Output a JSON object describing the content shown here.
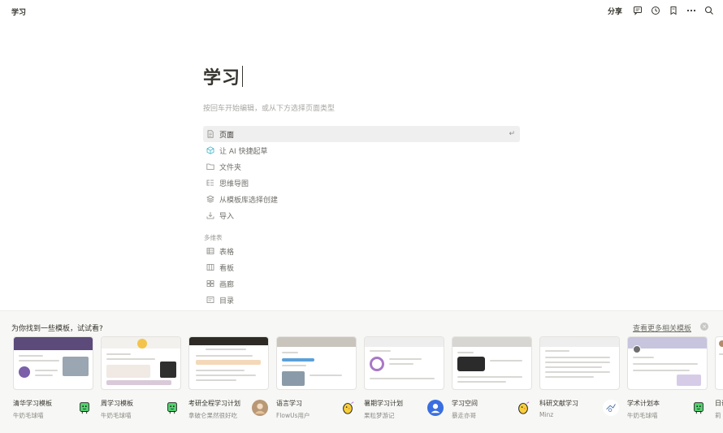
{
  "topbar": {
    "breadcrumb": "学习",
    "share_label": "分享",
    "icons": [
      "comment-icon",
      "history-icon",
      "bookmark-icon",
      "more-icon",
      "search-icon"
    ]
  },
  "editor": {
    "title": "学习",
    "hint": "按回车开始编辑，或从下方选择页面类型",
    "enter_symbol": "↵",
    "menu": [
      {
        "label": "页面",
        "icon": "page-icon"
      },
      {
        "label": "让 AI 快捷起草",
        "icon": "ai-cube-icon"
      },
      {
        "label": "文件夹",
        "icon": "folder-icon"
      },
      {
        "label": "思维导图",
        "icon": "mindmap-icon"
      },
      {
        "label": "从模板库选择创建",
        "icon": "template-icon"
      },
      {
        "label": "导入",
        "icon": "import-icon"
      }
    ],
    "section_label": "多维表",
    "table_menu": [
      {
        "label": "表格",
        "icon": "table-icon"
      },
      {
        "label": "看板",
        "icon": "kanban-icon"
      },
      {
        "label": "画廊",
        "icon": "gallery-icon"
      },
      {
        "label": "目录",
        "icon": "list-icon"
      }
    ]
  },
  "templates": {
    "title": "为你找到一些模板，试试看?",
    "more_link": "查看更多相关模板",
    "close_symbol": "×",
    "cards": [
      {
        "name": "清华学习模板",
        "author": "牛奶毛球喵",
        "band": "#5b4a7a",
        "avatar": "green-robot"
      },
      {
        "name": "周学习模板",
        "author": "牛奶毛球喵",
        "band": "#f3f1ee",
        "avatar": "green-robot"
      },
      {
        "name": "考研全程学习计划",
        "author": "拿破仑果然很好吃",
        "band": "#2e2a26",
        "avatar": "photo"
      },
      {
        "name": "语言学习",
        "author": "FlowUs用户",
        "band": "#c9c5bd",
        "avatar": "yellow-bird"
      },
      {
        "name": "暑期学习计划",
        "author": "果粒梦游记",
        "band": "#eeeeee",
        "avatar": "blue-person"
      },
      {
        "name": "学习空间",
        "author": "暴走亦哥",
        "band": "#d8d6d2",
        "avatar": "yellow-bird"
      },
      {
        "name": "科研文献学习",
        "author": "Minz",
        "band": "#eeeeee",
        "avatar": "sketch"
      },
      {
        "name": "学术计划本",
        "author": "牛奶毛球喵",
        "band": "#c7c4dd",
        "avatar": "green-robot"
      },
      {
        "name": "日语",
        "author": "莉",
        "band": "#ffffff",
        "avatar": "none"
      }
    ]
  }
}
